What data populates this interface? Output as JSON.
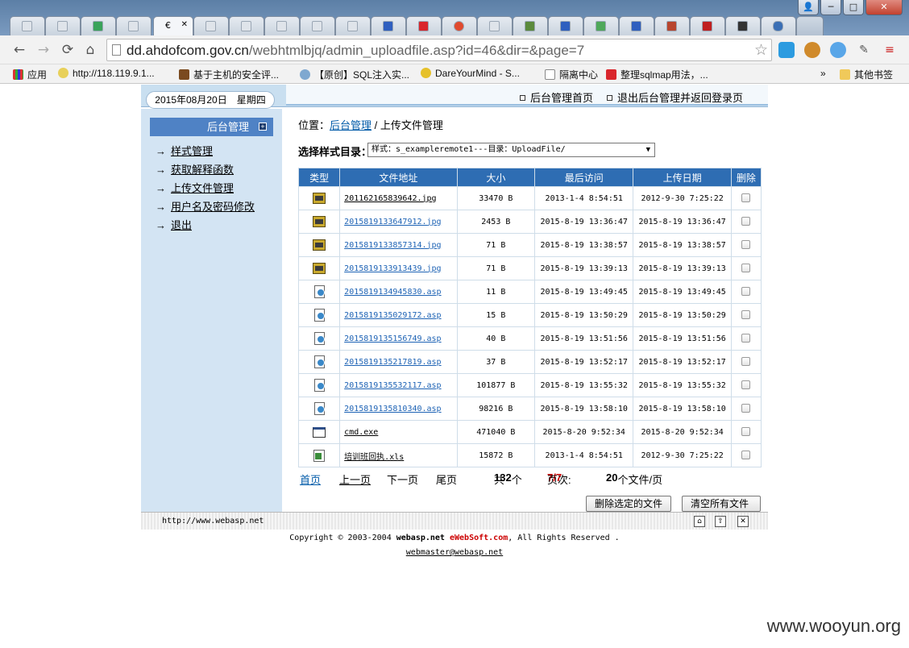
{
  "window": {
    "minimize": "─",
    "maximize": "□",
    "close": "✕",
    "user": "👤"
  },
  "tab_active_title": "€",
  "toolbar": {
    "url_host": "dd.ahdofcom.gov.cn",
    "url_path": "/webhtmlbjq/admin_uploadfile.asp?id=46&dir=&page=7",
    "star": "☆",
    "back": "←",
    "forward": "→",
    "reload": "⟳",
    "home": "⌂"
  },
  "bookmarks": {
    "items": [
      {
        "label": "应用"
      },
      {
        "label": "http://118.119.9.1..."
      },
      {
        "label": "基于主机的安全评..."
      },
      {
        "label": "【原创】SQL注入实..."
      },
      {
        "label": "DareYourMind - S..."
      },
      {
        "label": "隔离中心"
      },
      {
        "label": "整理sqlmap用法，..."
      }
    ],
    "more": "»",
    "other": "其他书签"
  },
  "header": {
    "date": "2015年08月20日　星期四",
    "link_home": "后台管理首页",
    "link_logout": "退出后台管理并返回登录页"
  },
  "sidebar": {
    "title": "后台管理",
    "plus": "+",
    "arrow": "→",
    "items": [
      {
        "label": "样式管理"
      },
      {
        "label": "获取解释函数"
      },
      {
        "label": "上传文件管理"
      },
      {
        "label": "用户名及密码修改"
      },
      {
        "label": "退出"
      }
    ]
  },
  "location": {
    "prefix": "位置：",
    "link": "后台管理",
    "sep": " / ",
    "current": "上传文件管理"
  },
  "style_select": {
    "label": "选择样式目录：",
    "value": "样式：s_exampleremote1---目录：UploadFile/",
    "arrow": "▼"
  },
  "table": {
    "headers": [
      "类型",
      "文件地址",
      "大小",
      "最后访问",
      "上传日期",
      "删除"
    ],
    "rows": [
      {
        "type": "jpg",
        "name": "201162165839642.jpg",
        "size": "33470 B",
        "accessed": "2013-1-4 8:54:51",
        "uploaded": "2012-9-30 7:25:22",
        "blue": false
      },
      {
        "type": "jpg",
        "name": "2015819133647912.jpg",
        "size": "2453 B",
        "accessed": "2015-8-19 13:36:47",
        "uploaded": "2015-8-19 13:36:47",
        "blue": true
      },
      {
        "type": "jpg",
        "name": "2015819133857314.jpg",
        "size": "71 B",
        "accessed": "2015-8-19 13:38:57",
        "uploaded": "2015-8-19 13:38:57",
        "blue": true
      },
      {
        "type": "jpg",
        "name": "2015819133913439.jpg",
        "size": "71 B",
        "accessed": "2015-8-19 13:39:13",
        "uploaded": "2015-8-19 13:39:13",
        "blue": true
      },
      {
        "type": "asp",
        "name": "2015819134945830.asp",
        "size": "11 B",
        "accessed": "2015-8-19 13:49:45",
        "uploaded": "2015-8-19 13:49:45",
        "blue": true
      },
      {
        "type": "asp",
        "name": "2015819135029172.asp",
        "size": "15 B",
        "accessed": "2015-8-19 13:50:29",
        "uploaded": "2015-8-19 13:50:29",
        "blue": true
      },
      {
        "type": "asp",
        "name": "2015819135156749.asp",
        "size": "40 B",
        "accessed": "2015-8-19 13:51:56",
        "uploaded": "2015-8-19 13:51:56",
        "blue": true
      },
      {
        "type": "asp",
        "name": "2015819135217819.asp",
        "size": "37 B",
        "accessed": "2015-8-19 13:52:17",
        "uploaded": "2015-8-19 13:52:17",
        "blue": true
      },
      {
        "type": "asp",
        "name": "2015819135532117.asp",
        "size": "101877 B",
        "accessed": "2015-8-19 13:55:32",
        "uploaded": "2015-8-19 13:55:32",
        "blue": true
      },
      {
        "type": "asp",
        "name": "2015819135810340.asp",
        "size": "98216 B",
        "accessed": "2015-8-19 13:58:10",
        "uploaded": "2015-8-19 13:58:10",
        "blue": true
      },
      {
        "type": "exe",
        "name": "cmd.exe",
        "size": "471040 B",
        "accessed": "2015-8-20 9:52:34",
        "uploaded": "2015-8-20 9:52:34",
        "blue": false
      },
      {
        "type": "xls",
        "name": "培训班回执.xls",
        "size": "15872 B",
        "accessed": "2013-1-4 8:54:51",
        "uploaded": "2012-9-30 7:25:22",
        "blue": false
      }
    ]
  },
  "pager": {
    "first": "首页",
    "prev": "上一页",
    "next": "下一页",
    "last": "尾页",
    "total_prefix": "共",
    "total": "132",
    "total_suffix": "个",
    "page_prefix": "页次:",
    "page": "7/7",
    "per_page": "20",
    "per_page_suffix": "个文件/页"
  },
  "actions": {
    "delete_selected": "删除选定的文件",
    "clear_all": "清空所有文件"
  },
  "statusbar": {
    "url": "http://www.webasp.net"
  },
  "footer": {
    "copy_prefix": "Copyright © 2003-2004 ",
    "brand1": "webasp.net",
    "brand2": "eWebSoft.com",
    "copy_suffix": ", All Rights Reserved .",
    "email": "webmaster@webasp.net"
  },
  "watermark": "www.wooyun.org",
  "colors": {
    "header_blue": "#2e6db3",
    "sidebar_bg": "#d3e4f3",
    "link_blue": "#005aa8"
  }
}
